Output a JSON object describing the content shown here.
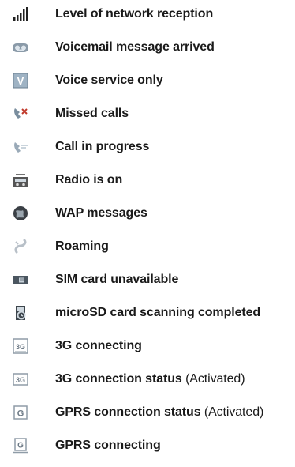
{
  "items": [
    {
      "icon": "signal-strength-icon",
      "label": "Level of network reception",
      "suffix": ""
    },
    {
      "icon": "voicemail-icon",
      "label": "Voicemail message arrived",
      "suffix": ""
    },
    {
      "icon": "voice-only-icon",
      "label": "Voice service only",
      "suffix": ""
    },
    {
      "icon": "missed-call-icon",
      "label": "Missed calls",
      "suffix": ""
    },
    {
      "icon": "call-in-progress-icon",
      "label": "Call in progress",
      "suffix": ""
    },
    {
      "icon": "radio-icon",
      "label": "Radio is on",
      "suffix": ""
    },
    {
      "icon": "wap-globe-icon",
      "label": "WAP messages",
      "suffix": ""
    },
    {
      "icon": "roaming-icon",
      "label": "Roaming",
      "suffix": ""
    },
    {
      "icon": "sim-card-icon",
      "label": "SIM card unavailable",
      "suffix": ""
    },
    {
      "icon": "microsd-scan-icon",
      "label": "microSD card scanning completed",
      "suffix": ""
    },
    {
      "icon": "3g-connecting-icon",
      "label": "3G connecting",
      "suffix": ""
    },
    {
      "icon": "3g-status-icon",
      "label": "3G connection status",
      "suffix": "(Activated)"
    },
    {
      "icon": "gprs-status-icon",
      "label": "GPRS connection status",
      "suffix": "(Activated)"
    },
    {
      "icon": "gprs-connecting-icon",
      "label": "GPRS connecting",
      "suffix": ""
    }
  ]
}
